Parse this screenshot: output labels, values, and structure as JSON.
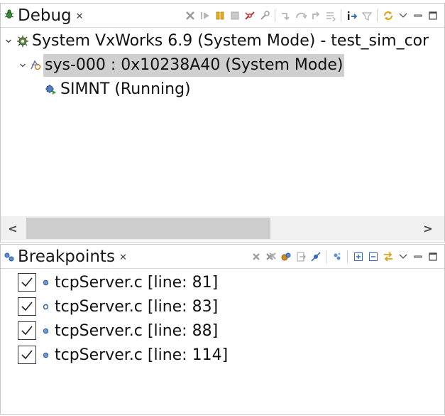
{
  "debug": {
    "tab_title": "Debug",
    "toolbar": [
      "remove-all-terminated-icon",
      "resume-icon",
      "suspend-icon",
      "terminate-icon",
      "disconnect-icon",
      "attach-icon",
      "step-into-icon",
      "step-over-icon",
      "step-return-icon",
      "drop-to-frame-icon",
      "instruction-step-icon",
      "use-step-filters-icon",
      "refresh-icon",
      "view-menu-icon",
      "minimize-icon",
      "maximize-icon"
    ],
    "tree": [
      {
        "label": "System VxWorks 6.9 (System Mode) - test_sim_cor",
        "depth": 0,
        "expanded": true,
        "selected": false
      },
      {
        "label": "sys-000 : 0x10238A40 (System Mode)",
        "depth": 1,
        "expanded": true,
        "selected": true
      },
      {
        "label": "SIMNT (Running)",
        "depth": 2,
        "expanded": false,
        "selected": false
      }
    ],
    "scroll_arrows": {
      "left": "<",
      "right": ">"
    }
  },
  "breakpoints": {
    "tab_title": "Breakpoints",
    "toolbar": [
      "remove-breakpoint-icon",
      "remove-all-breakpoints-icon",
      "show-supported-breakpoints-icon",
      "go-to-file-icon",
      "skip-all-breakpoints-icon",
      "add-breakpoint-icon",
      "expand-all-icon",
      "collapse-all-icon",
      "link-with-debug-view-icon",
      "view-menu-icon",
      "minimize-icon",
      "maximize-icon"
    ],
    "items": [
      {
        "label": "tcpServer.c [line: 81]",
        "checked": true
      },
      {
        "label": "tcpServer.c [line: 83]",
        "checked": true
      },
      {
        "label": "tcpServer.c [line: 88]",
        "checked": true
      },
      {
        "label": "tcpServer.c [line: 114]",
        "checked": true
      }
    ]
  },
  "colors": {
    "selection": "#cfcfcf",
    "accent": "#2f6fb3",
    "bug_green": "#3a8a3a"
  }
}
